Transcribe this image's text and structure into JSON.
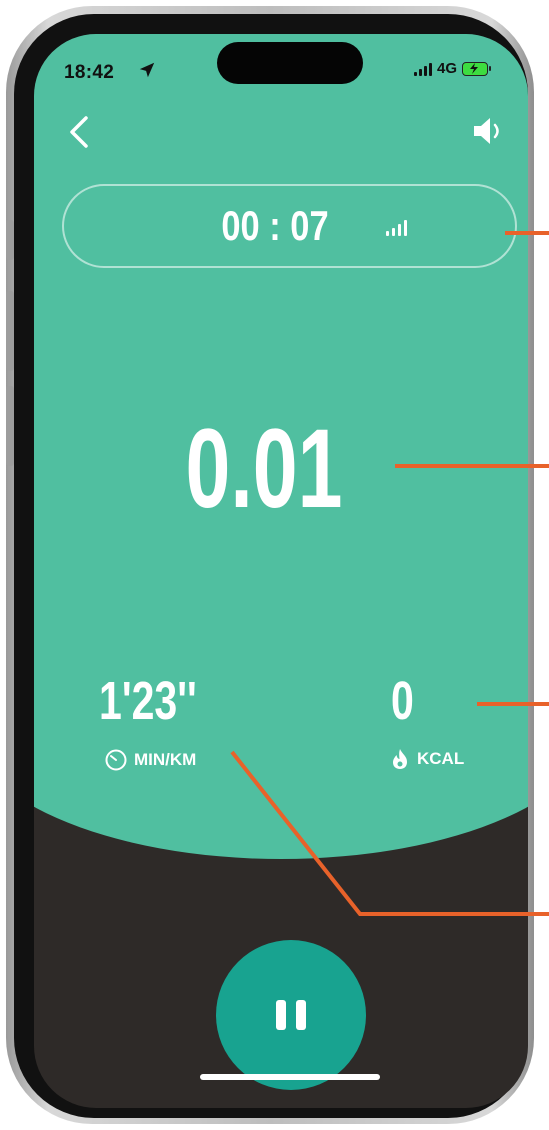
{
  "status_bar": {
    "time": "18:42",
    "network": "4G",
    "icons": [
      "location-arrow-icon",
      "signal-icon",
      "battery-charging-icon"
    ]
  },
  "nav": {
    "back_icon": "chevron-left-icon",
    "sound_icon": "speaker-icon"
  },
  "timer": {
    "elapsed": "00 : 07",
    "gps_icon": "gps-signal-icon"
  },
  "distance": {
    "value": "0.01"
  },
  "stats": {
    "pace_value": "1'23''",
    "pace_unit": "MIN/KM",
    "pace_icon": "stopwatch-icon",
    "calories_value": "0",
    "calories_unit": "KCAL",
    "calories_icon": "flame-icon"
  },
  "controls": {
    "pause_icon": "pause-icon"
  },
  "colors": {
    "accent_green": "#50bfa0",
    "pause_teal": "#18a390",
    "dark_background": "#2e2a28",
    "callout_orange": "#e8622a"
  }
}
